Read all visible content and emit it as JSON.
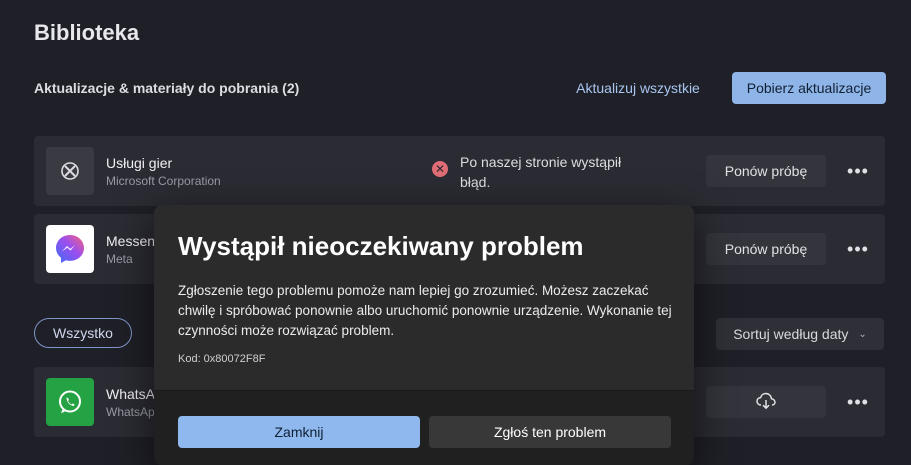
{
  "header": {
    "title": "Biblioteka",
    "section_title": "Aktualizacje & materiały do pobrania (2)",
    "update_all_label": "Aktualizuj wszystkie",
    "get_updates_label": "Pobierz aktualizacje"
  },
  "updates": [
    {
      "name": "Usługi gier",
      "publisher": "Microsoft Corporation",
      "status_line1": "Po naszej stronie wystąpił",
      "status_line2": "błąd.",
      "action_label": "Ponów próbę",
      "icon": "xbox-icon"
    },
    {
      "name": "Messen",
      "publisher": "Meta",
      "action_label": "Ponów próbę",
      "icon": "messenger-icon"
    }
  ],
  "filters": {
    "all_label": "Wszystko",
    "sort_label": "Sortuj według daty"
  },
  "library": [
    {
      "name": "WhatsA",
      "publisher": "WhatsAp",
      "icon": "whatsapp-icon"
    }
  ],
  "dialog": {
    "title": "Wystąpił nieoczekiwany problem",
    "body": "Zgłoszenie tego problemu pomoże nam lepiej go zrozumieć. Możesz zaczekać chwilę i spróbować ponownie albo uruchomić ponownie urządzenie. Wykonanie tej czynności może rozwiązać problem.",
    "code": "Kod: 0x80072F8F",
    "close_label": "Zamknij",
    "report_label": "Zgłoś ten problem"
  },
  "colors": {
    "background": "#1f1f27",
    "accent": "#8fb4e8",
    "error": "#e06d76",
    "whatsapp": "#25a244"
  }
}
